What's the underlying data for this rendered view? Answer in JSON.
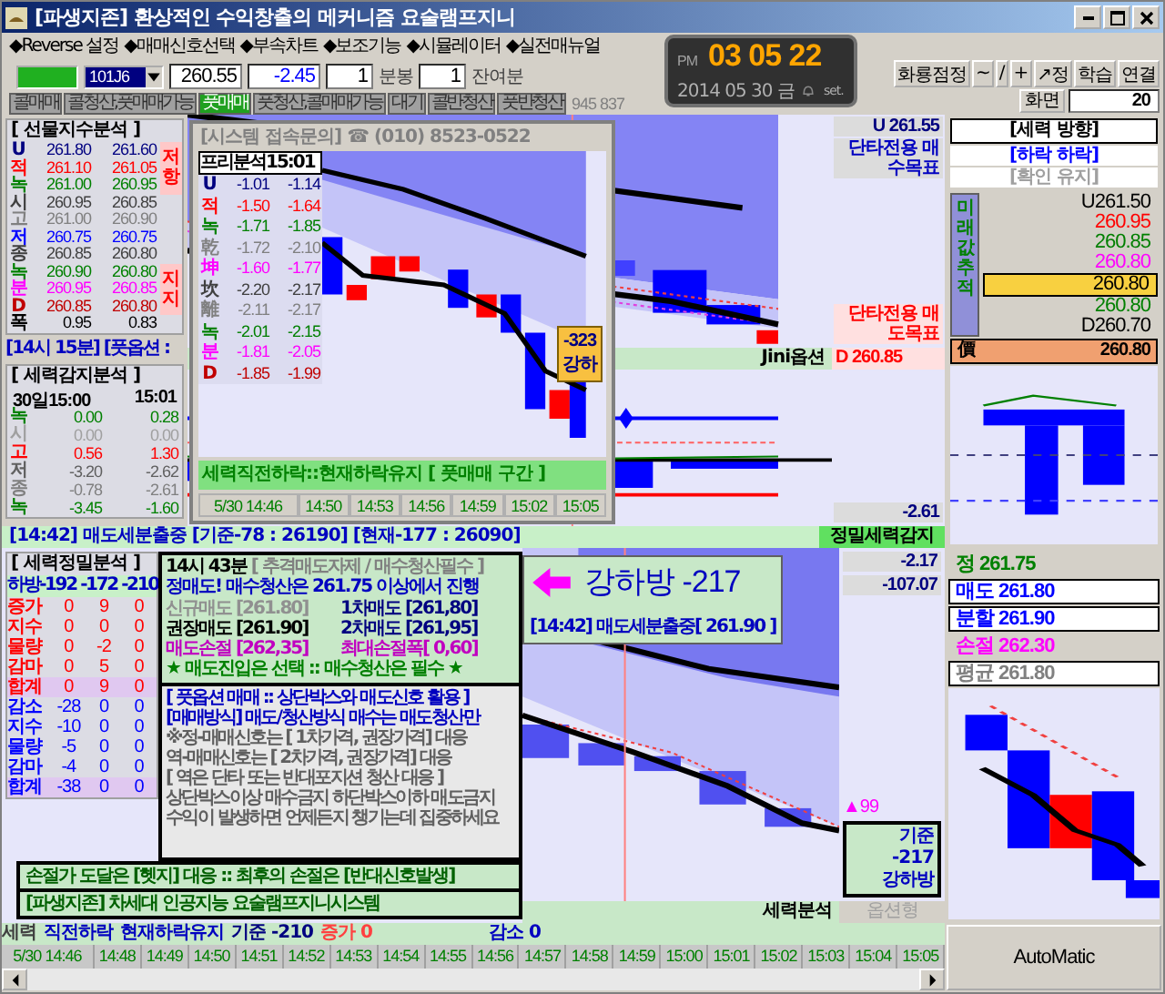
{
  "window": {
    "title": "[파생지존] 환상적인 수익창출의 메커니즘 요술램프지니"
  },
  "menu": [
    "◆Reverse 설정",
    "◆매매신호선택",
    "◆부속차트",
    "◆보조기능",
    "◆시뮬레이터",
    "◆실전매뉴얼"
  ],
  "toolbar": {
    "code": "101J6",
    "price": "260.55",
    "change": "-2.45",
    "bar_count": "1",
    "bar_unit": "분봉",
    "remaining": "1",
    "remaining_label": "잔여분",
    "counter": "945 837",
    "modes": [
      {
        "label": "콜매매",
        "selected": false
      },
      {
        "label": "콜청산,풋매매가능",
        "selected": false
      },
      {
        "label": "풋매매",
        "selected": true
      },
      {
        "label": "풋청산,콜매매가능",
        "selected": false
      },
      {
        "label": "대기",
        "selected": false
      },
      {
        "label": "콜반청산",
        "selected": false
      },
      {
        "label": "풋반청산",
        "selected": false
      }
    ]
  },
  "clock": {
    "meridiem": "PM",
    "time": "03 05 22",
    "date": "2014 05 30 금",
    "set_label": "set."
  },
  "tools": [
    "화룡점정",
    "~",
    "/",
    "+",
    "↗정",
    "학습",
    "연결"
  ],
  "screen": {
    "label": "화면",
    "value": "20"
  },
  "futures_index": {
    "title": "[ 선물지수분석 ]",
    "resistance": "저항",
    "support": "지지",
    "rows": [
      {
        "label": "U",
        "values": [
          "261.80",
          "261.60"
        ],
        "color": "#000080"
      },
      {
        "label": "적",
        "values": [
          "261.10",
          "261.05"
        ],
        "color": "#ff0000"
      },
      {
        "label": "녹",
        "values": [
          "261.00",
          "260.95"
        ],
        "color": "#008000"
      },
      {
        "label": "시",
        "values": [
          "260.95",
          "260.85"
        ],
        "color": "#404040"
      },
      {
        "label": "고",
        "values": [
          "261.00",
          "260.90"
        ],
        "color": "#808080"
      },
      {
        "label": "저",
        "values": [
          "260.75",
          "260.75"
        ],
        "color": "#0000ff"
      },
      {
        "label": "종",
        "values": [
          "260.85",
          "260.80"
        ],
        "color": "#404040"
      },
      {
        "label": "녹",
        "values": [
          "260.90",
          "260.80"
        ],
        "color": "#008000"
      },
      {
        "label": "분",
        "values": [
          "260.95",
          "260.85"
        ],
        "color": "#ff00ff"
      },
      {
        "label": "D",
        "values": [
          "260.85",
          "260.80"
        ],
        "color": "#c00000"
      },
      {
        "label": "폭",
        "values": [
          "0.95",
          "0.83"
        ],
        "color": "#000000"
      }
    ]
  },
  "alert_1415": "[14시 15분] [풋옵션 :",
  "force_detect": {
    "title": "[ 세력감지분석 ]",
    "headers": [
      "30일15:00",
      "15:01"
    ],
    "rows": [
      {
        "label": "녹",
        "values": [
          "0.00",
          "0.28"
        ],
        "color": "#008000"
      },
      {
        "label": "시",
        "values": [
          "0.00",
          "0.00"
        ],
        "color": "#a0a0a0"
      },
      {
        "label": "고",
        "values": [
          "0.56",
          "1.30"
        ],
        "color": "#ff0000"
      },
      {
        "label": "저",
        "values": [
          "-3.20",
          "-2.62"
        ],
        "color": "#606060"
      },
      {
        "label": "종",
        "values": [
          "-0.78",
          "-2.61"
        ],
        "color": "#808080"
      },
      {
        "label": "녹",
        "values": [
          "-3.45",
          "-1.60"
        ],
        "color": "#008000"
      }
    ]
  },
  "alert_bar": {
    "text": "[14:42] 매도세분출중 [기준-78 : 26190] [현재-177 : 26090]",
    "label": "정밀세력감지"
  },
  "main_chart": {
    "upper_value": "U 261.55",
    "upper_target": "단타전용 매수목표",
    "lower_target": "단타전용 매도목표",
    "strip_label": "Jini옵션",
    "lower_value": "D 260.85"
  },
  "oscillator": {
    "value": "-2.61"
  },
  "direction": {
    "title": "[세력 방향]",
    "state": "[하락 하락]",
    "confirm": "[확인 유지]",
    "tracker_label": "미래값추적",
    "price_label": "價",
    "price": "260.80",
    "levels": [
      {
        "text": "U261.50",
        "color": "#000000",
        "selected": false
      },
      {
        "text": "260.95",
        "color": "#ff0000",
        "selected": false
      },
      {
        "text": "260.85",
        "color": "#008000",
        "selected": false
      },
      {
        "text": "260.80",
        "color": "#ff00ff",
        "selected": false
      },
      {
        "text": "260.80",
        "color": "#000000",
        "selected": true
      },
      {
        "text": "260.80",
        "color": "#008000",
        "selected": false
      },
      {
        "text": "D260.70",
        "color": "#000000",
        "selected": false
      }
    ]
  },
  "popup": {
    "title": "[시스템 접속문의] ☎ (010) 8523-0522",
    "table_title": "프리분석15:01",
    "badge_value": "-323",
    "badge_label": "강하",
    "status": "세력직전하락::현재하락유지 [ 풋매매 구간 ]",
    "rows": [
      {
        "label": "U",
        "values": [
          "-1.01",
          "-1.14"
        ],
        "color": "#000080"
      },
      {
        "label": "적",
        "values": [
          "-1.50",
          "-1.64"
        ],
        "color": "#ff0000"
      },
      {
        "label": "녹",
        "values": [
          "-1.71",
          "-1.85"
        ],
        "color": "#008000"
      },
      {
        "label": "乾",
        "values": [
          "-1.72",
          "-2.10"
        ],
        "color": "#808080"
      },
      {
        "label": "坤",
        "values": [
          "-1.60",
          "-1.77"
        ],
        "color": "#ff00ff"
      },
      {
        "label": "坎",
        "values": [
          "-2.20",
          "-2.17"
        ],
        "color": "#404040"
      },
      {
        "label": "離",
        "values": [
          "-2.11",
          "-2.17"
        ],
        "color": "#808080"
      },
      {
        "label": "녹",
        "values": [
          "-2.01",
          "-2.15"
        ],
        "color": "#008000"
      },
      {
        "label": "분",
        "values": [
          "-1.81",
          "-2.05"
        ],
        "color": "#ff00ff"
      },
      {
        "label": "D",
        "values": [
          "-1.85",
          "-1.99"
        ],
        "color": "#c00000"
      }
    ],
    "times": [
      "5/30 14:46",
      "14:50",
      "14:53",
      "14:56",
      "14:59",
      "15:02",
      "15:05"
    ]
  },
  "precision": {
    "title": "[ 세력정밀분석 ]",
    "header": "하방-192 -172 -210",
    "rows": [
      {
        "label": "증가",
        "values": [
          "0",
          "9",
          "0"
        ],
        "color": "#ff0000",
        "total": false
      },
      {
        "label": "지수",
        "values": [
          "0",
          "0",
          "0"
        ],
        "color": "#ff0000",
        "total": false
      },
      {
        "label": "물량",
        "values": [
          "0",
          "-2",
          "0"
        ],
        "color": "#ff0000",
        "total": false
      },
      {
        "label": "감마",
        "values": [
          "0",
          "5",
          "0"
        ],
        "color": "#ff0000",
        "total": false
      },
      {
        "label": "합계",
        "values": [
          "0",
          "9",
          "0"
        ],
        "color": "#ff0000",
        "total": true
      },
      {
        "label": "감소",
        "values": [
          "-28",
          "0",
          "0"
        ],
        "color": "#0000ff",
        "total": false
      },
      {
        "label": "지수",
        "values": [
          "-10",
          "0",
          "0"
        ],
        "color": "#0000ff",
        "total": false
      },
      {
        "label": "물량",
        "values": [
          "-5",
          "0",
          "0"
        ],
        "color": "#0000ff",
        "total": false
      },
      {
        "label": "감마",
        "values": [
          "-4",
          "0",
          "0"
        ],
        "color": "#0000ff",
        "total": false
      },
      {
        "label": "합계",
        "values": [
          "-38",
          "0",
          "0"
        ],
        "color": "#0000ff",
        "total": true
      }
    ]
  },
  "signal": {
    "time": "14시 43분",
    "note": "[ 추격매도자제 / 매수청산필수 ]",
    "headline": "정매도! 매수청산은 261.75 이상에서 진행",
    "prices": [
      {
        "text": "신규매도 [261.80]",
        "color": "#909090"
      },
      {
        "text": "1차매도 [261,80]",
        "color": "#000080"
      },
      {
        "text": "권장매도 [261.90]",
        "color": "#000000"
      },
      {
        "text": "2차매도 [261,95]",
        "color": "#000080"
      },
      {
        "text": "매도손절 [262,35]",
        "color": "#c000c0"
      },
      {
        "text": "최대손절폭[ 0,60]",
        "color": "#c000c0"
      }
    ],
    "footer": "★ 매도진입은 선택 :: 매수청산은 필수 ★"
  },
  "guide": [
    {
      "text": "[ 풋옵션 매매 :: 상단박스와 매도신호 활용 ]",
      "color": "#0000c0"
    },
    {
      "text": "[매매방식] 매도/청산방식 매수는 매도청산만",
      "color": "#0000c0"
    },
    {
      "text": "※정-매매신호는 [ 1차가격, 권장가격] 대응",
      "color": "#606060"
    },
    {
      "text": "역-매매신호는 [ 2차가격, 권장가격] 대응",
      "color": "#606060"
    },
    {
      "text": "[ 역은 단타 또는 반대포지션 청산 대응 ]",
      "color": "#606060"
    },
    {
      "text": "상단박스이상 매수금지  하단박스이하 매도금지",
      "color": "#606060"
    },
    {
      "text": "수익이 발생하면 언제든지 챙기는데 집중하세요",
      "color": "#606060"
    }
  ],
  "notices": [
    "손절가 도달은 [헷지] 대응 :: 최후의 손절은 [반대신호발생]",
    "[파생지존] 차세대 인공지능 요술램프지니시스템"
  ],
  "callout": {
    "text": "강하방 -217",
    "detail": "[14:42] 매도세분출중[ 261.90 ]"
  },
  "lower_chart": {
    "values": [
      "-2.17",
      "-107.07"
    ],
    "basis_label": "기준",
    "basis_value": "-217",
    "basis_state": "강하방",
    "marker": "▲99",
    "strip_label": "세력분석",
    "strip_tail": "옵션형"
  },
  "orders": [
    {
      "label": "정",
      "value": "261.75",
      "color": "#008000",
      "boxed": false
    },
    {
      "label": "매도",
      "value": "261.80",
      "color": "#0000ff",
      "boxed": true
    },
    {
      "label": "분할",
      "value": "261.90",
      "color": "#0000ff",
      "boxed": true
    },
    {
      "label": "손절",
      "value": "262.30",
      "color": "#ff00ff",
      "boxed": false
    },
    {
      "label": "평균",
      "value": "261.80",
      "color": "#808080",
      "boxed": true
    }
  ],
  "status": {
    "force": "세력",
    "prev": "직전하락",
    "current": "현재하락유지",
    "basis": "기준 -210",
    "increase": "증가 0",
    "decrease": "감소 0"
  },
  "times": [
    "5/30 14:46",
    "14:48",
    "14:49",
    "14:50",
    "14:51",
    "14:52",
    "14:53",
    "14:54",
    "14:55",
    "14:56",
    "14:57",
    "14:58",
    "14:59",
    "15:00",
    "15:01",
    "15:02",
    "15:03",
    "15:04",
    "15:05"
  ],
  "automatic": "AutoMatic"
}
